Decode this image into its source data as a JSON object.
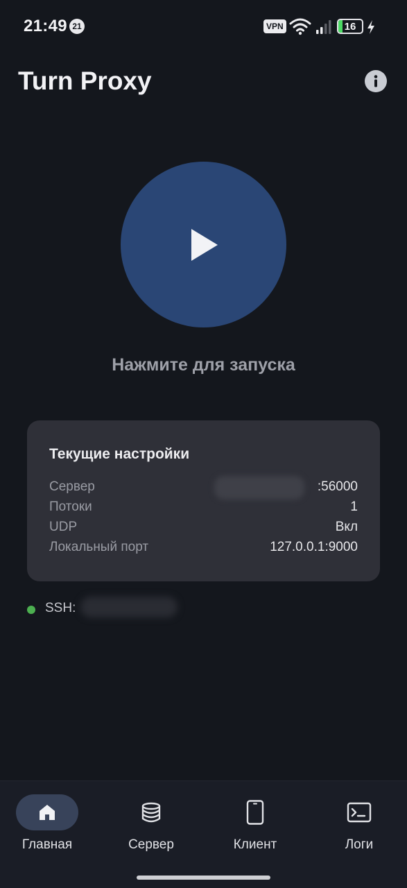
{
  "status_bar": {
    "time": "21:49",
    "notification_count": "21",
    "vpn_label": "VPN",
    "battery_level": "16",
    "battery_color": "#4cd964",
    "icons": [
      "wifi-icon",
      "signal-icon",
      "battery-icon",
      "charging-bolt-icon"
    ]
  },
  "header": {
    "title": "Turn Proxy",
    "info_icon": "info-icon"
  },
  "play": {
    "icon": "play-icon",
    "accent_color": "#2a4675",
    "hint": "Нажмите для запуска"
  },
  "settings": {
    "title": "Текущие настройки",
    "rows": [
      {
        "label": "Сервер",
        "value": ":56000"
      },
      {
        "label": "Потоки",
        "value": "1"
      },
      {
        "label": "UDP",
        "value": "Вкл"
      },
      {
        "label": "Локальный порт",
        "value": "127.0.0.1:9000"
      }
    ]
  },
  "ssh": {
    "label": "SSH:",
    "status_color": "#4caf50"
  },
  "nav": {
    "items": [
      {
        "label": "Главная",
        "icon": "home-icon",
        "active": true
      },
      {
        "label": "Сервер",
        "icon": "database-icon",
        "active": false
      },
      {
        "label": "Клиент",
        "icon": "phone-icon",
        "active": false
      },
      {
        "label": "Логи",
        "icon": "terminal-icon",
        "active": false
      }
    ]
  }
}
